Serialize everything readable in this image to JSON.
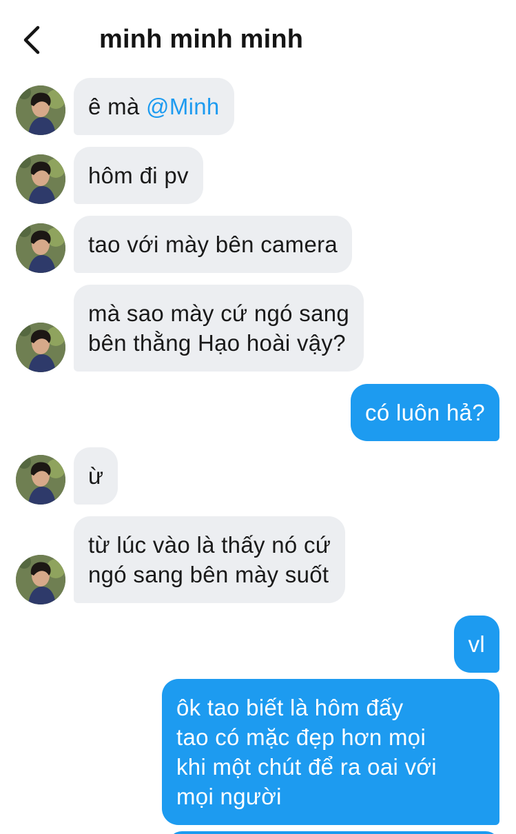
{
  "header": {
    "back_icon": "chevron-left-icon",
    "title": "minh minh minh"
  },
  "colors": {
    "incoming_bubble": "#eceef1",
    "outgoing_bubble": "#1d9bf0",
    "mention": "#1d9bf0"
  },
  "messages": [
    {
      "direction": "in",
      "text_prefix": "ê mà ",
      "mention": "@Minh"
    },
    {
      "direction": "in",
      "text": "hôm đi pv"
    },
    {
      "direction": "in",
      "text": "tao với mày bên camera"
    },
    {
      "direction": "in",
      "lines": [
        "mà sao mày cứ ngó sang",
        "bên thằng Hạo hoài vậy?"
      ]
    },
    {
      "direction": "out",
      "text": "có luôn hả?"
    },
    {
      "direction": "in",
      "text": "ừ"
    },
    {
      "direction": "in",
      "lines": [
        "từ lúc vào là thấy nó cứ",
        "ngó sang bên mày suốt"
      ]
    },
    {
      "direction": "out",
      "text": "vl"
    },
    {
      "direction": "out",
      "lines": [
        "ôk tao biết là hôm đấy",
        "tao có mặc đẹp hơn mọi",
        "khi một chút để ra oai với",
        "mọi người"
      ]
    }
  ]
}
